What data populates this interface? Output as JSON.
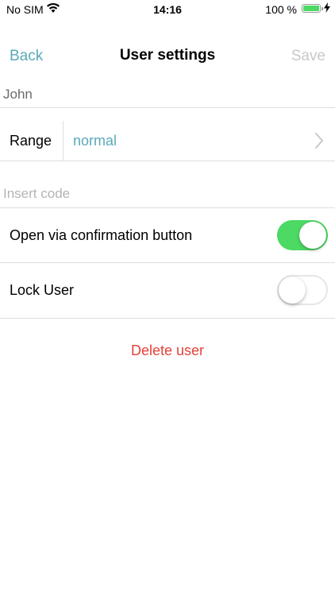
{
  "status_bar": {
    "carrier": "No SIM",
    "time": "14:16",
    "battery": "100 %",
    "icons": [
      "wifi-icon",
      "battery-icon",
      "charging-bolt-icon"
    ]
  },
  "nav": {
    "back": "Back",
    "title": "User settings",
    "save": "Save"
  },
  "form": {
    "name_value": "John",
    "range_label": "Range",
    "range_value": "normal",
    "code_placeholder": "Insert code",
    "code_value": "",
    "toggles": [
      {
        "label": "Open via confirmation button",
        "on": true
      },
      {
        "label": "Lock User",
        "on": false
      }
    ],
    "delete_label": "Delete user"
  },
  "colors": {
    "accent": "#5aaab8",
    "switch_on": "#4cd964",
    "destructive": "#e5413a",
    "disabled": "#c8c8c8"
  }
}
